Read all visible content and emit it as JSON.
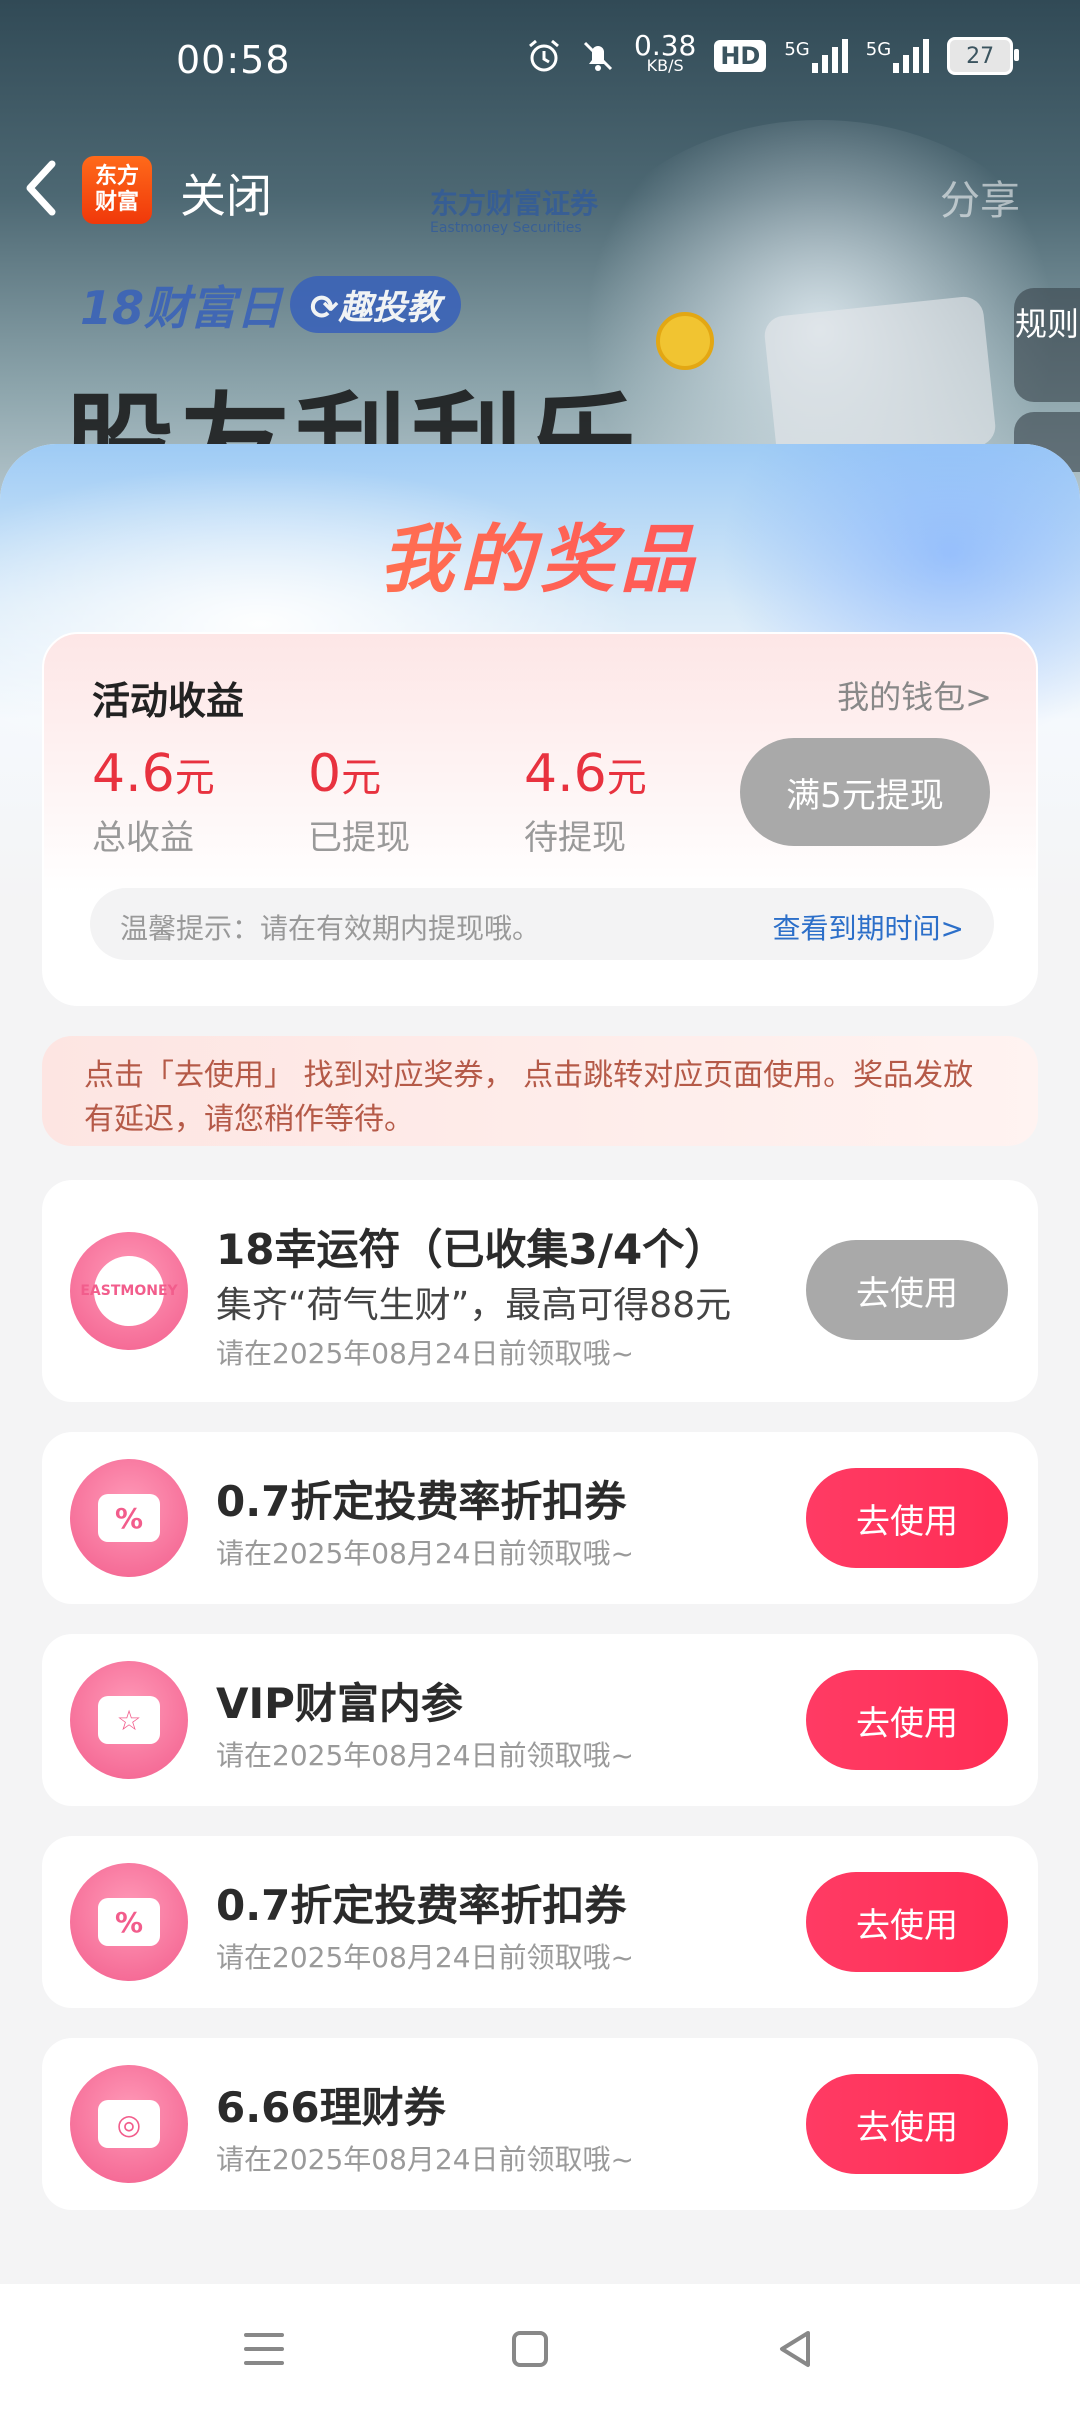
{
  "status_bar": {
    "time": "00:58",
    "net_speed_value": "0.38",
    "net_speed_unit": "KB/S",
    "hd_label": "HD",
    "signal1_label": "5G",
    "signal2_label": "5G",
    "battery": "27"
  },
  "navbar": {
    "logo_line1": "东方",
    "logo_line2": "财富",
    "close_label": "关闭",
    "brand_name": "东方财富证券",
    "brand_sub": "Eastmoney Securities",
    "share_label": "分享"
  },
  "banner": {
    "event_tag": "18财富日",
    "event_badge": "趣投教",
    "big_title": "股友刮刮乐",
    "rule_label": "规则"
  },
  "sheet": {
    "title": "我的奖品"
  },
  "earnings": {
    "title": "活动收益",
    "wallet_link": "我的钱包>",
    "total_value": "4.6",
    "total_unit": "元",
    "total_label": "总收益",
    "withdrawn_value": "0",
    "withdrawn_unit": "元",
    "withdrawn_label": "已提现",
    "pending_value": "4.6",
    "pending_unit": "元",
    "pending_label": "待提现",
    "withdraw_button": "满5元提现",
    "tip_text": "温馨提示：请在有效期内提现哦。",
    "expiry_link": "查看到期时间>"
  },
  "notice": "点击「去使用」 找到对应奖券， 点击跳转对应页面使用。奖品发放有延迟，请您稍作等待。",
  "prizes": [
    {
      "name": "18幸运符（已收集3/4个）",
      "desc": "集齐“荷气生财”，最高可得88元",
      "date": "请在2025年08月24日前领取哦~",
      "button": "去使用",
      "icon": "eastmoney-badge-icon",
      "icon_text": "EASTMONEY",
      "disabled": true
    },
    {
      "name": "0.7折定投费率折扣券",
      "date": "请在2025年08月24日前领取哦~",
      "button": "去使用",
      "icon": "discount-coupon-icon",
      "icon_text": "%"
    },
    {
      "name": "VIP财富内参",
      "date": "请在2025年08月24日前领取哦~",
      "button": "去使用",
      "icon": "vip-star-ticket-icon",
      "icon_text": "☆"
    },
    {
      "name": "0.7折定投费率折扣券",
      "date": "请在2025年08月24日前领取哦~",
      "button": "去使用",
      "icon": "discount-coupon-icon",
      "icon_text": "%"
    },
    {
      "name": "6.66理财券",
      "date": "请在2025年08月24日前领取哦~",
      "button": "去使用",
      "icon": "finance-ticket-icon",
      "icon_text": "◎"
    }
  ],
  "system_nav": {
    "menu_icon": "☰",
    "home_icon": "▢",
    "back_icon": "◁"
  },
  "colors": {
    "accent_red": "#ff2d55",
    "value_red": "#e8323f",
    "disabled_gray": "#a9a9a9",
    "link_blue": "#2c6fc9"
  }
}
